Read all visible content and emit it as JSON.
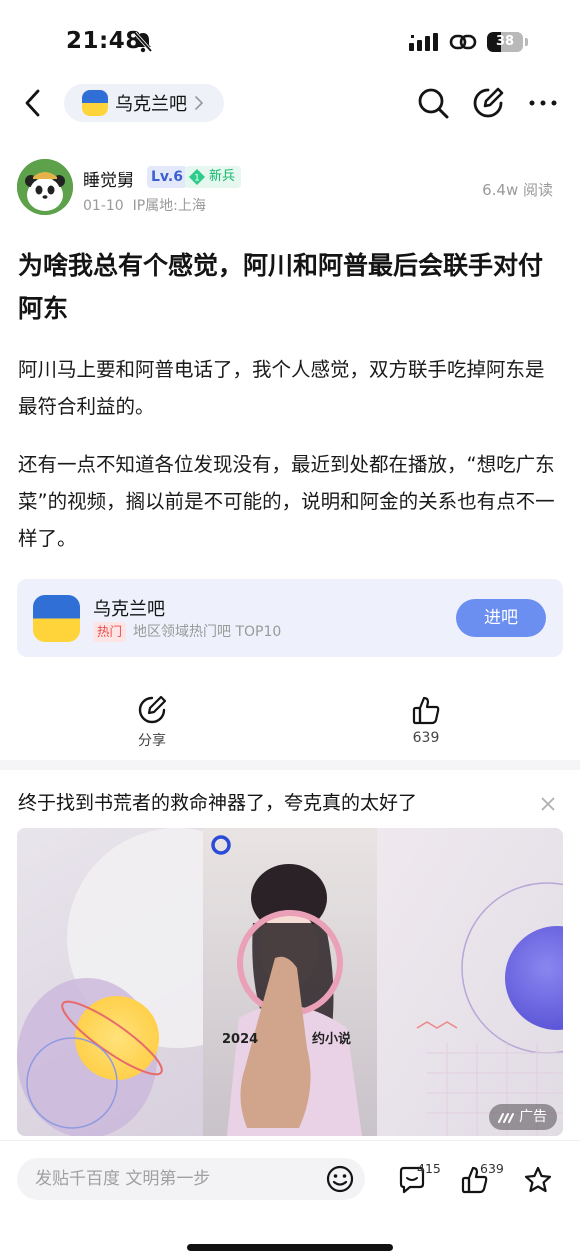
{
  "status_bar": {
    "time": "21:48",
    "battery": "38",
    "battery_level": 0.38,
    "icons": [
      "bell-slash-icon",
      "signal-icon",
      "link-icon",
      "battery-icon"
    ]
  },
  "nav": {
    "forum_name": "乌克兰吧",
    "icons": [
      "back-icon",
      "search-icon",
      "edit-icon",
      "more-icon"
    ]
  },
  "author": {
    "name": "睡觉舅",
    "level": "Lv.6",
    "badge_num": "1",
    "badge_text": "新兵",
    "date": "01-10",
    "ip": "IP属地:上海",
    "reads": "6.4w 阅读"
  },
  "post": {
    "title": "为啥我总有个感觉，阿川和阿普最后会联手对付阿东",
    "paragraphs": [
      "阿川马上要和阿普电话了，我个人感觉，双方联手吃掉阿东是最符合利益的。",
      "还有一点不知道各位发现没有，最近到处都在播放，“想吃广东菜”的视频，搁以前是不可能的，说明和阿金的关系也有点不一样了。"
    ]
  },
  "forum_card": {
    "name": "乌克兰吧",
    "hot_tag": "热门",
    "desc": "地区领域热门吧 TOP10",
    "button": "进吧"
  },
  "actions": {
    "share_label": "分享",
    "like_count": "639"
  },
  "ad": {
    "title": "终于找到书荒者的救命神器了，夸克真的太好了",
    "badge": "广告",
    "image_caption": "2024",
    "image_caption_2": "约小说"
  },
  "bottom_bar": {
    "reply_placeholder": "发贴千百度 文明第一步",
    "comment_count": "415",
    "like_count": "639"
  },
  "colors": {
    "accent": "#6b8ef1",
    "flag_blue": "#2f6fd6",
    "flag_yellow": "#ffd43b",
    "hot_red": "#f04a4a",
    "green_badge": "#12b76a"
  }
}
